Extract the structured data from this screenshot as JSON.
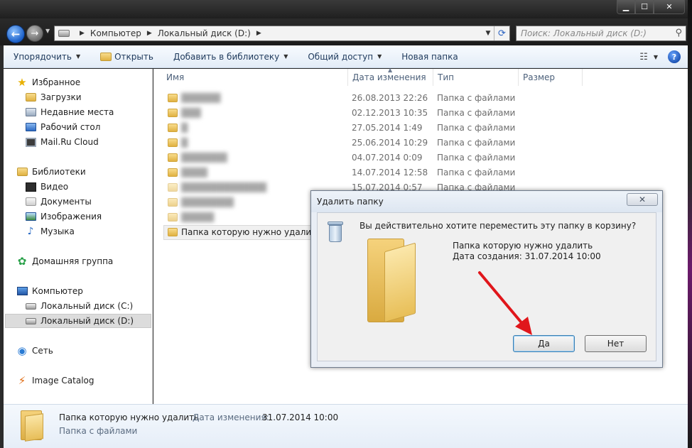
{
  "window": {
    "address": {
      "crumbs": [
        "Компьютер",
        "Локальный диск (D:)"
      ]
    },
    "search_placeholder": "Поиск: Локальный диск (D:)",
    "caption": {
      "min": "▁",
      "max": "☐",
      "close": "✕"
    }
  },
  "toolbar": {
    "organize": "Упорядочить",
    "open": "Открыть",
    "add_to_library": "Добавить в библиотеку",
    "share": "Общий доступ",
    "new_folder": "Новая папка",
    "help": "?"
  },
  "nav": {
    "favorites": "Избранное",
    "downloads": "Загрузки",
    "recent": "Недавние места",
    "desktop": "Рабочий стол",
    "mailru": "Mail.Ru Cloud",
    "libraries": "Библиотеки",
    "video": "Видео",
    "documents": "Документы",
    "images": "Изображения",
    "music": "Музыка",
    "homegroup": "Домашняя группа",
    "computer": "Компьютер",
    "disk_c": "Локальный диск (C:)",
    "disk_d": "Локальный диск (D:)",
    "network": "Сеть",
    "image_catalog": "Image Catalog"
  },
  "columns": {
    "name": "Имя",
    "modified": "Дата изменения",
    "type": "Тип",
    "size": "Размер"
  },
  "files": [
    {
      "name": "",
      "date": "26.08.2013 22:26",
      "type": "Папка с файлами"
    },
    {
      "name": "",
      "date": "02.12.2013 10:35",
      "type": "Папка с файлами"
    },
    {
      "name": "",
      "date": "27.05.2014 1:49",
      "type": "Папка с файлами"
    },
    {
      "name": "",
      "date": "25.06.2014 10:29",
      "type": "Папка с файлами"
    },
    {
      "name": "",
      "date": "04.07.2014 0:09",
      "type": "Папка с файлами"
    },
    {
      "name": "",
      "date": "14.07.2014 12:58",
      "type": "Папка с файлами"
    },
    {
      "name": "",
      "date": "15.07.2014 0:57",
      "type": "Папка с файлами"
    },
    {
      "name": "",
      "date": "",
      "type": ""
    },
    {
      "name": "Папка которую нужно удалить",
      "date": "",
      "type": ""
    }
  ],
  "details": {
    "name": "Папка которую нужно удалить",
    "modified_label": "Дата изменения:",
    "modified_value": "31.07.2014 10:00",
    "type": "Папка с файлами"
  },
  "dialog": {
    "title": "Удалить папку",
    "close": "✕",
    "question": "Вы действительно хотите переместить эту папку в корзину?",
    "folder_name": "Папка которую нужно удалить",
    "created": "Дата создания: 31.07.2014 10:00",
    "yes": "Да",
    "no": "Нет"
  },
  "colors": {
    "arrow": "#e0161b",
    "accent": "#1e395b"
  }
}
